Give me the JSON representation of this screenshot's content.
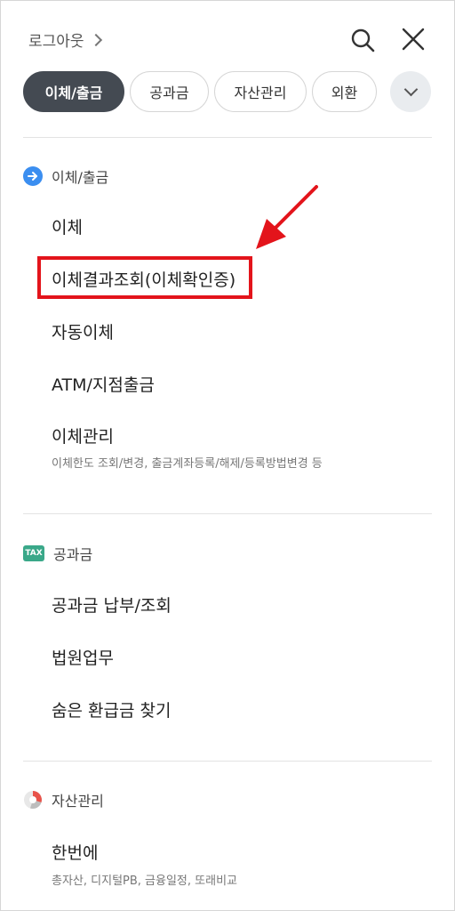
{
  "header": {
    "logout_label": "로그아웃"
  },
  "tabs": [
    {
      "label": "이체/출금",
      "active": true
    },
    {
      "label": "공과금"
    },
    {
      "label": "자산관리"
    },
    {
      "label": "외환"
    }
  ],
  "sections": {
    "transfer": {
      "title": "이체/출금",
      "items": [
        {
          "label": "이체"
        },
        {
          "label": "이체결과조회(이체확인증)"
        },
        {
          "label": "자동이체"
        },
        {
          "label": "ATM/지점출금"
        },
        {
          "label": "이체관리",
          "sub": "이체한도 조회/변경, 출금계좌등록/해제/등록방법변경 등"
        }
      ]
    },
    "utility": {
      "title": "공과금",
      "badge": "TAX",
      "items": [
        {
          "label": "공과금 납부/조회"
        },
        {
          "label": "법원업무"
        },
        {
          "label": "숨은 환급금 찾기"
        }
      ]
    },
    "asset": {
      "title": "자산관리",
      "items": [
        {
          "label": "한번에",
          "sub": "총자산, 디지털PB, 금융일정, 또래비교"
        }
      ]
    }
  },
  "colors": {
    "active_tab": "#444a52",
    "highlight": "#e3141b",
    "transfer_icon": "#3b8ef0",
    "tax_badge": "#3aa889"
  }
}
